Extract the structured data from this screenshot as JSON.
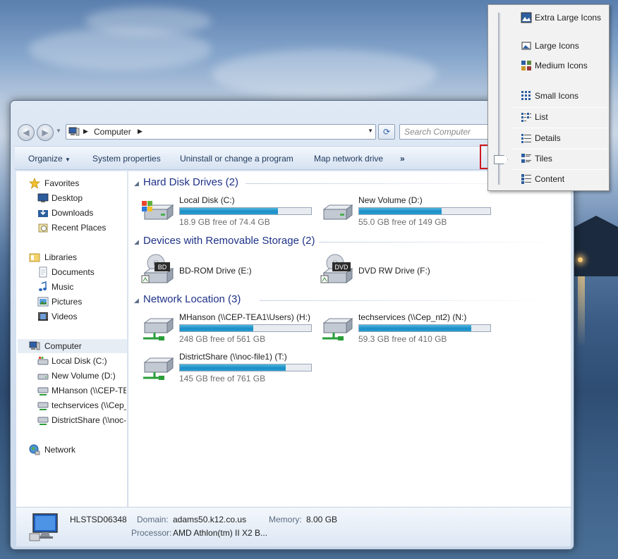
{
  "address_bar": {
    "path": [
      "Computer"
    ],
    "search_placeholder": "Search Computer"
  },
  "toolbar": {
    "organize": "Organize",
    "system_properties": "System properties",
    "uninstall": "Uninstall or change a program",
    "map_network_drive": "Map network drive",
    "more": "»"
  },
  "nav": {
    "favorites": "Favorites",
    "desktop": "Desktop",
    "downloads": "Downloads",
    "recent_places": "Recent Places",
    "libraries": "Libraries",
    "documents": "Documents",
    "music": "Music",
    "pictures": "Pictures",
    "videos": "Videos",
    "computer": "Computer",
    "local_disk": "Local Disk (C:)",
    "new_volume": "New Volume (D:)",
    "mhanson": "MHanson (\\\\CEP-TEA1\\Users) (H:)",
    "techservices": "techservices (\\\\Cep_nt2) (N:)",
    "districtshare": "DistrictShare (\\\\noc-file1) (T:)",
    "network": "Network"
  },
  "groups": {
    "hard_disks": "Hard Disk Drives (2)",
    "removable": "Devices with Removable Storage (2)",
    "network": "Network Location (3)"
  },
  "drives": {
    "c": {
      "name": "Local Disk (C:)",
      "free": "18.9 GB free of 74.4 GB",
      "used_pct": 74.6
    },
    "d": {
      "name": "New Volume (D:)",
      "free": "55.0 GB free of 149 GB",
      "used_pct": 63.1
    },
    "e": {
      "name": "BD-ROM Drive (E:)",
      "label": "BD"
    },
    "f": {
      "name": "DVD RW Drive (F:)",
      "label": "DVD"
    },
    "h": {
      "name": "MHanson (\\\\CEP-TEA1\\Users) (H:)",
      "free": "248 GB free of 561 GB",
      "used_pct": 55.8
    },
    "n": {
      "name": "techservices (\\\\Cep_nt2) (N:)",
      "free": "59.3 GB free of 410 GB",
      "used_pct": 85.5
    },
    "t": {
      "name": "DistrictShare (\\\\noc-file1) (T:)",
      "free": "145 GB free of 761 GB",
      "used_pct": 80.9
    }
  },
  "details": {
    "computer_name": "HLSTSD06348",
    "domain_label": "Domain:",
    "domain": "adams50.k12.co.us",
    "memory_label": "Memory:",
    "memory": "8.00 GB",
    "processor_label": "Processor:",
    "processor": "AMD Athlon(tm) II X2 B..."
  },
  "views_menu": {
    "items": [
      "Extra Large Icons",
      "Large Icons",
      "Medium Icons",
      "Small Icons",
      "List",
      "Details",
      "Tiles",
      "Content"
    ],
    "selected": "Tiles"
  },
  "colors": {
    "group_header": "#1e3287",
    "bar_fill": "#1d8cc7",
    "highlight_box": "#d0181f"
  }
}
